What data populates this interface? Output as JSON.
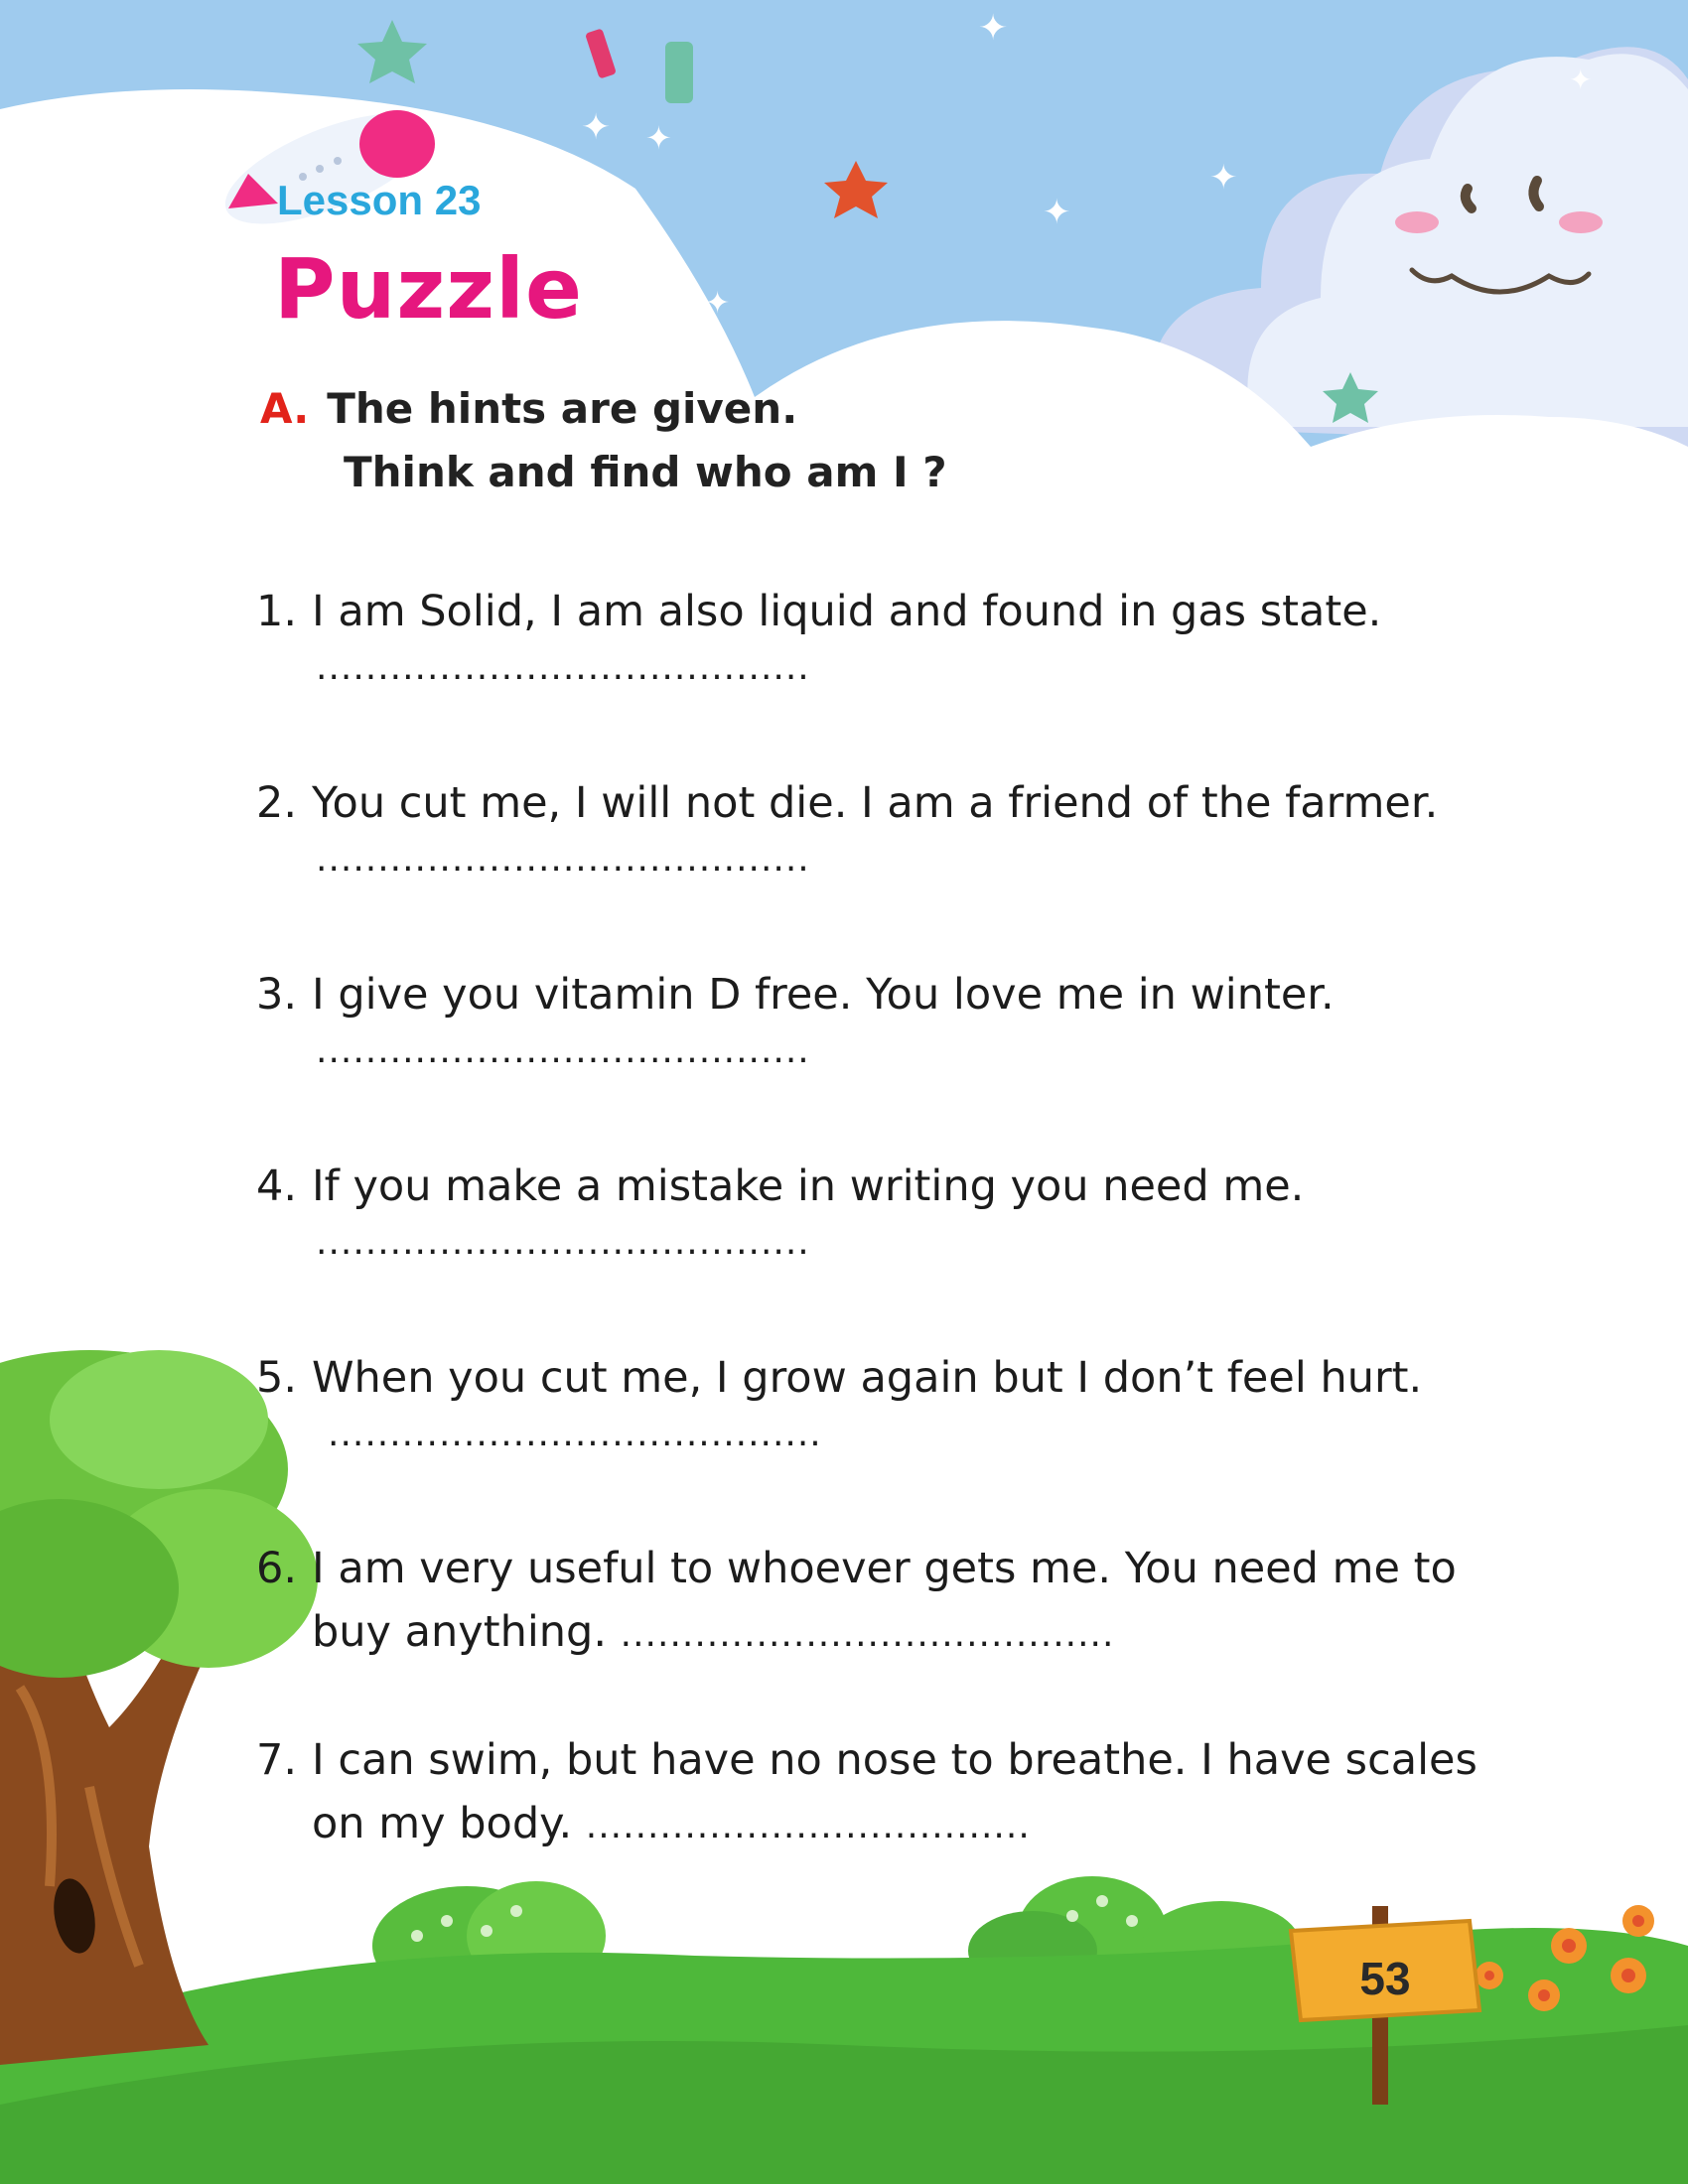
{
  "lesson_label": "Lesson 23",
  "title": "Puzzle",
  "section": {
    "letter": "A.",
    "line1": "The hints are given.",
    "line2": "Think and find who am I ?"
  },
  "questions": [
    {
      "num": "1.",
      "text": "I am Solid, I am also liquid and found in gas state.",
      "blank": "........................................"
    },
    {
      "num": "2.",
      "text": "You cut me, I will not die. I am a friend of the farmer.",
      "blank": "........................................"
    },
    {
      "num": "3.",
      "text": "I give you vitamin D free. You love me in winter.",
      "blank": "........................................"
    },
    {
      "num": "4.",
      "text": "If you make a mistake in writing you need me.",
      "blank": "........................................"
    },
    {
      "num": "5.",
      "text": "When you cut me, I grow again but I don’t feel hurt.",
      "blank": "........................................"
    },
    {
      "num": "6.",
      "text": "I am very useful to whoever gets me. You need me to",
      "cont": "buy anything.",
      "blank": "........................................"
    },
    {
      "num": "7.",
      "text": "I can swim, but have no nose to breathe. I have scales",
      "cont": "on my body.",
      "blank": "...................................."
    }
  ],
  "page_number": "53",
  "colors": {
    "sky": "#9fcbee",
    "title_pink": "#e6177e",
    "lesson_blue": "#2aa7dc",
    "section_red": "#e2231a",
    "grass": "#4eb83a",
    "sign": "#f3ab2e"
  },
  "decorations": [
    "airplane-icon",
    "star-icon",
    "cloud-face-icon",
    "tree-icon",
    "bush-icon",
    "flower-icon",
    "signpost-icon"
  ]
}
